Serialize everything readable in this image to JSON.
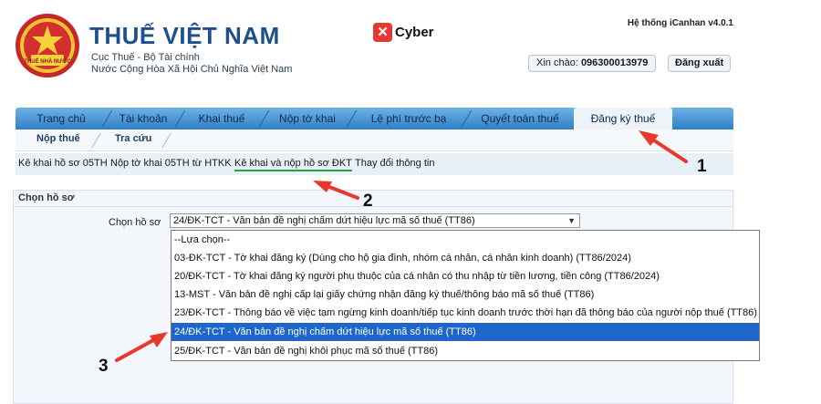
{
  "header": {
    "brand_title": "THUẾ VIỆT NAM",
    "brand_sub1": "Cục Thuế - Bộ Tài chính",
    "brand_sub2": "Nước Cộng Hòa Xã Hội Chủ Nghĩa Việt Nam",
    "emblem_text": "THUẾ NHÀ NƯỚC",
    "cyber_logo_text": "Cyber",
    "system_version": "Hệ thống iCanhan v4.0.1",
    "greeting_label": "Xin chào:",
    "greeting_user": "096300013979",
    "logout_label": "Đăng xuất"
  },
  "main_nav": {
    "tabs": [
      {
        "label": "Trang chủ"
      },
      {
        "label": "Tài khoản"
      },
      {
        "label": "Khai thuế"
      },
      {
        "label": "Nộp tờ khai"
      },
      {
        "label": "Lệ phí trước bạ"
      },
      {
        "label": "Quyết toán thuế"
      },
      {
        "label": "Đăng ký thuế",
        "active": true
      }
    ]
  },
  "sub_nav": {
    "items": [
      {
        "label": "Nộp thuế"
      },
      {
        "label": "Tra cứu"
      }
    ]
  },
  "link_bar": {
    "links": [
      {
        "label": "Kê khai hồ sơ 05TH"
      },
      {
        "label": "Nộp tờ khai 05TH từ HTKK"
      },
      {
        "label": "Kê khai và nộp hồ sơ ĐKT",
        "highlighted": true
      },
      {
        "label": "Thay đổi thông tin"
      }
    ]
  },
  "panel": {
    "title": "Chọn hồ sơ",
    "field_label": "Chọn hồ sơ",
    "selected_value": "24/ĐK-TCT - Văn bản đề nghị chấm dứt hiệu lực mã số thuế (TT86)",
    "options": [
      "--Lựa chọn--",
      "03-ĐK-TCT - Tờ khai đăng ký (Dùng cho hộ gia đình, nhóm cá nhân, cá nhân kinh doanh) (TT86/2024)",
      "20/ĐK-TCT - Tờ khai đăng ký người phụ thuộc của cá nhân có thu nhập từ tiền lương, tiền công (TT86/2024)",
      "13-MST - Văn bản đề nghị cấp lại giấy chứng nhận đăng ký thuế/thông báo mã số thuế (TT86)",
      "23/ĐK-TCT - Thông báo về việc tạm ngừng kinh doanh/tiếp tục kinh doanh trước thời hạn đã thông báo của người nộp thuế (TT86)",
      "24/ĐK-TCT - Văn bản đề nghị chấm dứt hiệu lực mã số thuế (TT86)",
      "25/ĐK-TCT - Văn bản đề nghị khôi phục mã số thuế (TT86)"
    ],
    "selected_index": 5
  },
  "annotations": {
    "numbers": [
      "1",
      "2",
      "3"
    ],
    "arrow_color": "#e8372c"
  },
  "colors": {
    "brand_blue": "#1e4f8e",
    "nav_blue": "#2f7fc6",
    "highlight_green": "#2e9e44",
    "selected_option": "#1e67c8"
  }
}
